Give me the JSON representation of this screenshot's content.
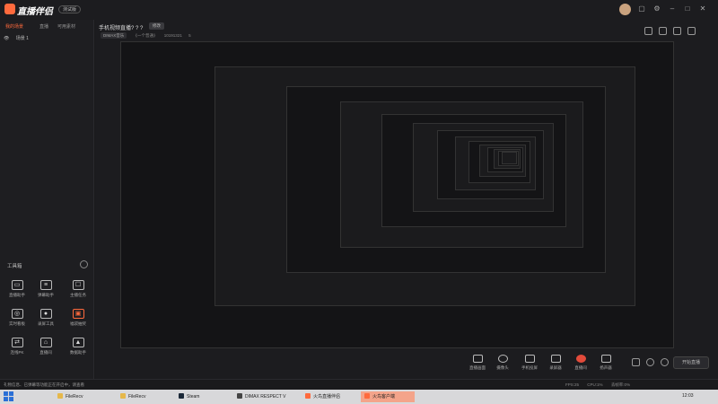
{
  "app": {
    "name": "直播伴侣",
    "beta": "测试版"
  },
  "left": {
    "tabs": [
      "我的场景",
      "直播",
      "可用素材"
    ],
    "scene": "场景 1",
    "toolbox_title": "工具箱",
    "tools": [
      "直播助手",
      "弹幕助手",
      "主播任务",
      "实时看板",
      "录屏工具",
      "福袋抽奖",
      "连线PK",
      "直播间",
      "数据助手"
    ]
  },
  "center": {
    "title": "手机视频直播? ? ?",
    "edit": "修改",
    "meta": {
      "tag": "DIMAX音乐",
      "label": "《一个普通》",
      "id": "10191321",
      "fans": "5"
    }
  },
  "bottom_tools": [
    "直播画面",
    "摄像头",
    "手机投屏",
    "录屏器",
    "直播间",
    "扬声器"
  ],
  "start_button": "开始直播",
  "status": {
    "message": "礼物信息、已弹幕等功能正在开启中，请查看",
    "fps": "FPS:25",
    "cpu": "CPU:1%",
    "net": "丢帧率:0%"
  },
  "taskbar": {
    "apps": [
      {
        "label": "FileRecv",
        "color": "#e6b84a"
      },
      {
        "label": "FileRecv",
        "color": "#e6b84a"
      },
      {
        "label": "Steam",
        "color": "#1b2838"
      },
      {
        "label": "DIMAX RESPECT V",
        "color": "#444444"
      },
      {
        "label": "火鸟直播伴侣",
        "color": "#ff6a3d"
      },
      {
        "label": "火鸟客户端",
        "color": "#ff6a3d"
      }
    ],
    "time": "12:03"
  },
  "colors": {
    "accent": "#ff6a3d",
    "panel": "#1e1e21",
    "canvas": "#111111"
  }
}
